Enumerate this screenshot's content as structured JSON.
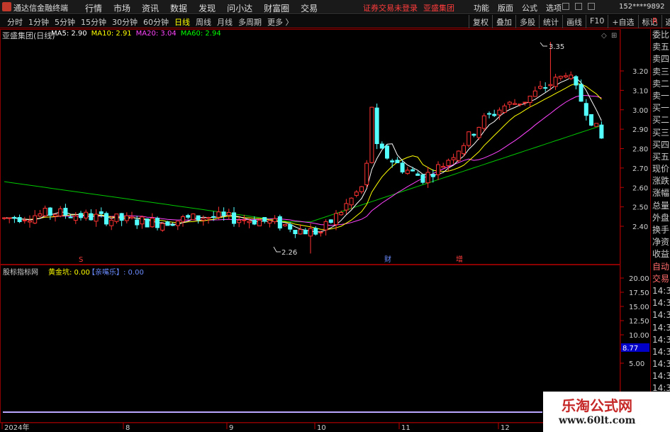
{
  "app": {
    "title": "通达信金融终端"
  },
  "menu": [
    "行情",
    "市场",
    "资讯",
    "数据",
    "发现",
    "问小达",
    "财富圈",
    "交易"
  ],
  "notice": [
    "证券交易未登录",
    "亚盛集团"
  ],
  "sys_menu": [
    "功能",
    "版面",
    "公式",
    "选项"
  ],
  "user": "152****9892",
  "periods": [
    {
      "label": "分时",
      "active": false
    },
    {
      "label": "1分钟",
      "active": false
    },
    {
      "label": "5分钟",
      "active": false
    },
    {
      "label": "15分钟",
      "active": false
    },
    {
      "label": "30分钟",
      "active": false
    },
    {
      "label": "60分钟",
      "active": false
    },
    {
      "label": "日线",
      "active": true
    },
    {
      "label": "周线",
      "active": false
    },
    {
      "label": "月线",
      "active": false
    },
    {
      "label": "多周期",
      "active": false
    },
    {
      "label": "更多 〉",
      "active": false
    }
  ],
  "toolbar": [
    "复权",
    "叠加",
    "多股",
    "统计",
    "画线",
    "F10",
    "+自选",
    "标记",
    "返回"
  ],
  "side_marker": "R",
  "stock": {
    "name": "亚盛集团(日线)"
  },
  "ma_legend": [
    {
      "label": "MA5: 2.90",
      "color": "#ffffff"
    },
    {
      "label": "MA10: 2.91",
      "color": "#ffff00"
    },
    {
      "label": "MA20: 3.04",
      "color": "#ff44ff"
    },
    {
      "label": "MA60: 2.94",
      "color": "#00ff00"
    }
  ],
  "indicator": {
    "name": "股标指标网",
    "v1": "黄金坑: 0.00",
    "v2": "【亲嘴乐】: 0.00"
  },
  "side_panel": [
    "委比",
    "卖五",
    "卖四",
    "卖三",
    "卖二",
    "卖一",
    "买一",
    "买二",
    "买三",
    "买四",
    "买五",
    "现价",
    "涨跌",
    "涨幅",
    "总量",
    "外盘",
    "换手",
    "净资",
    "收益",
    "自动",
    "交易",
    "14:3",
    "14:3",
    "14:3",
    "14:3",
    "14:3",
    "14:3",
    "14:3",
    "14:3",
    "14:3"
  ],
  "watermark": {
    "text": "乐淘公式网",
    "url": "www.60lt.com"
  },
  "chart_data": {
    "type": "candlestick",
    "title": "亚盛集团(日线)",
    "price_axis": {
      "ticks": [
        2.4,
        2.5,
        2.6,
        2.7,
        2.8,
        2.9,
        3.0,
        3.1,
        3.2
      ],
      "range": [
        2.2,
        3.4
      ]
    },
    "indicator_axis": {
      "ticks": [
        20.0,
        17.5,
        15.0,
        12.5,
        10.0,
        7.5,
        5.0
      ],
      "current": "8.77"
    },
    "time_labels": [
      "2024年",
      "8",
      "9",
      "10",
      "11",
      "12"
    ],
    "annotations": [
      {
        "text": "3.35",
        "kind": "high"
      },
      {
        "text": "2.26",
        "kind": "low"
      },
      {
        "text": "S",
        "kind": "signal"
      },
      {
        "text": "财",
        "kind": "event"
      },
      {
        "text": "增",
        "kind": "event"
      }
    ],
    "ma_lines": [
      "MA5",
      "MA10",
      "MA20",
      "MA60"
    ]
  }
}
